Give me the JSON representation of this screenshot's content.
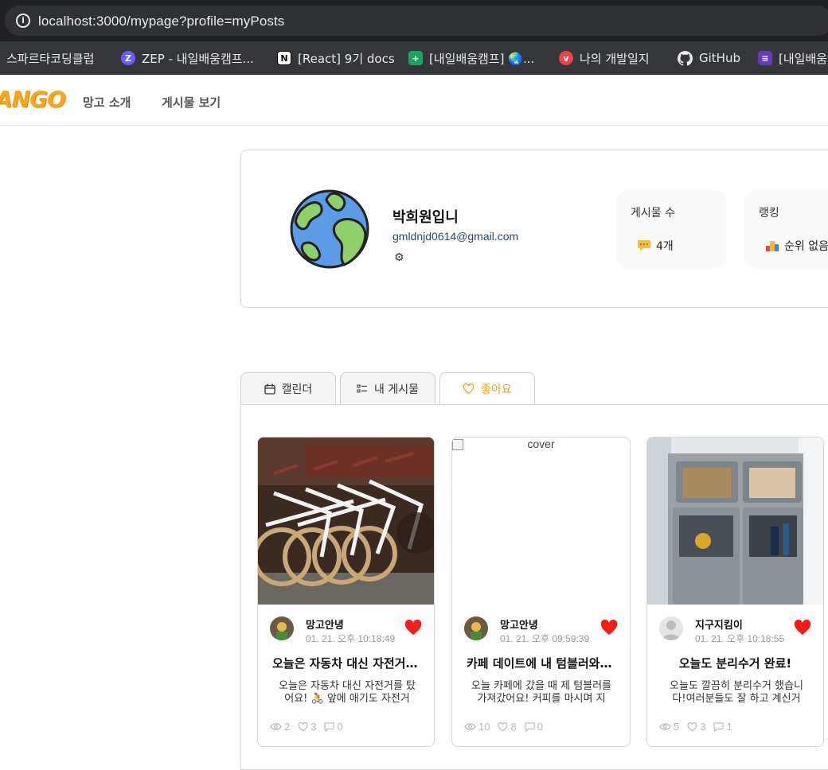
{
  "browser": {
    "url": "localhost:3000/mypage?profile=myPosts",
    "bookmarks": [
      {
        "label": "스파르타코딩클럽",
        "icon": "none"
      },
      {
        "label": "ZEP - 내일배움캠프...",
        "icon": "zep-icon",
        "color": "#6b5cff"
      },
      {
        "label": "[React] 9기 docs",
        "icon": "notion-icon"
      },
      {
        "label": "[내일배움캠프] 🌏...",
        "icon": "sheets-icon",
        "color": "#1aa260"
      },
      {
        "label": "나의 개발일지",
        "icon": "velog-icon",
        "color": "#f04444"
      },
      {
        "label": "GitHub",
        "icon": "github-icon"
      },
      {
        "label": "[내일배움",
        "icon": "forms-icon",
        "color": "#673ab7"
      }
    ]
  },
  "header": {
    "logo": "ANGO",
    "nav": [
      "망고 소개",
      "게시물 보기"
    ]
  },
  "profile": {
    "name": "박희원입니",
    "email": "gmldnjd0614@gmail.com",
    "stats": [
      {
        "label": "게시물 수",
        "value": "4개",
        "icon": "message-icon"
      },
      {
        "label": "랭킹",
        "value": "순위 없음",
        "icon": "ranking-icon"
      }
    ]
  },
  "tabs": [
    {
      "label": "캘린더",
      "icon": "calendar-icon"
    },
    {
      "label": "내 게시물",
      "icon": "list-icon"
    },
    {
      "label": "좋아요",
      "icon": "heart-outline-icon"
    }
  ],
  "posts": [
    {
      "author": "망고안녕",
      "time": "01. 21. 오후 10:18:49",
      "title": "오늘은 자동차 대신 자전거 ...",
      "body": "오늘은 자동차 대신 자전거를 탔어요! 🚴 앞에 애기도 자전거 타...",
      "views": "2",
      "likes": "3",
      "comments": "0",
      "cover": "bicycles"
    },
    {
      "author": "망고안녕",
      "time": "01. 21. 오후 09:59:39",
      "title": "카페 데이트에 내 텀블러와 ...",
      "body": "오늘 카페에 갔을 때 제 텀블러를 가져갔어요! 커피를 마시며 지구...",
      "views": "10",
      "likes": "8",
      "comments": "0",
      "cover": "broken",
      "cover_alt": "cover"
    },
    {
      "author": "지구지킴이",
      "time": "01. 21. 오후 10:18:55",
      "title": "오늘도 분리수거 완료!",
      "body": "오늘도 깔끔히 분리수거 했습니다!여러분들도 잘 하고 계신거죠...",
      "views": "5",
      "likes": "3",
      "comments": "1",
      "cover": "bins"
    }
  ]
}
